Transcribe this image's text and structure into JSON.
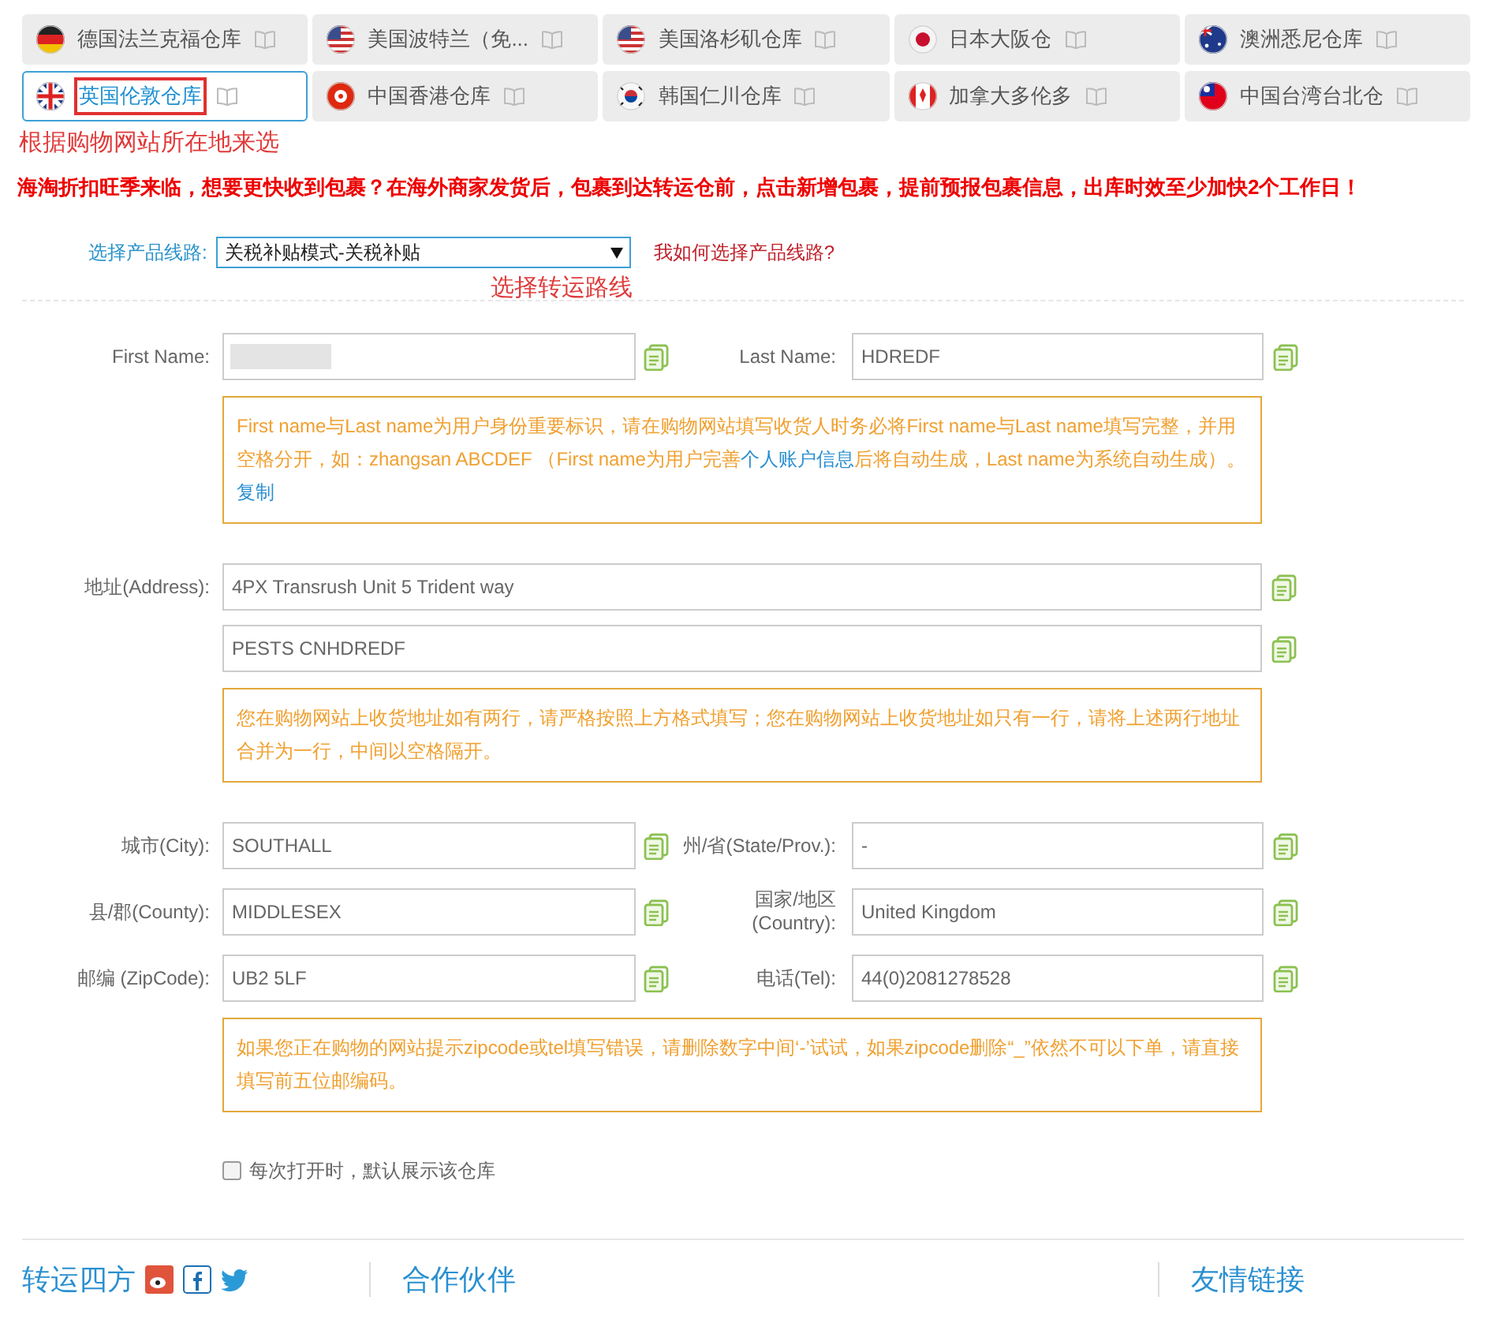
{
  "tabs": [
    {
      "label": "德国法兰克福仓库",
      "kind": "de",
      "selected": false,
      "highlighted": false
    },
    {
      "label": "美国波特兰（免...",
      "kind": "us",
      "selected": false,
      "highlighted": false
    },
    {
      "label": "美国洛杉矶仓库",
      "kind": "us",
      "selected": false,
      "highlighted": false
    },
    {
      "label": "日本大阪仓",
      "kind": "jp",
      "selected": false,
      "highlighted": false
    },
    {
      "label": "澳洲悉尼仓库",
      "kind": "au",
      "selected": false,
      "highlighted": false
    },
    {
      "label": "英国伦敦仓库",
      "kind": "gb",
      "selected": true,
      "highlighted": true
    },
    {
      "label": "中国香港仓库",
      "kind": "hk",
      "selected": false,
      "highlighted": false
    },
    {
      "label": "韩国仁川仓库",
      "kind": "kr",
      "selected": false,
      "highlighted": false
    },
    {
      "label": "加拿大多伦多",
      "kind": "ca",
      "selected": false,
      "highlighted": false
    },
    {
      "label": "中国台湾台北仓",
      "kind": "tw",
      "selected": false,
      "highlighted": false
    }
  ],
  "tab_annotation": "根据购物网站所在地来选",
  "promo": "海淘折扣旺季来临，想要更快收到包裹？在海外商家发货后，包裹到达转运仓前，点击新增包裹，提前预报包裹信息，出库时效至少加快2个工作日！",
  "route": {
    "label": "选择产品线路:",
    "value": "关税补贴模式-关税补贴",
    "help_link": "我如何选择产品线路?",
    "annotation": "选择转运路线"
  },
  "form": [
    {
      "kind": "pair",
      "fields": [
        {
          "label": "First Name:",
          "redacted": true
        },
        {
          "label": "Last Name:",
          "value": "HDREDF"
        }
      ]
    },
    {
      "kind": "note",
      "segments": [
        {
          "kind": "text",
          "text": "First name与Last name为用户身份重要标识，请在购物网站填写收货人时务必将First name与Last name填写完整，并用空格分开，如：zhangsan ABCDEF （First name为用户完善"
        },
        {
          "kind": "link",
          "text": "个人账户信息"
        },
        {
          "kind": "text",
          "text": "后将自动生成，Last name为系统自动生成）。 "
        },
        {
          "kind": "link",
          "text": "复制"
        }
      ]
    },
    {
      "kind": "full",
      "label": "地址(Address):",
      "value": "4PX Transrush Unit 5 Trident way"
    },
    {
      "kind": "full",
      "value": "PESTS CNHDREDF"
    },
    {
      "kind": "note",
      "segments": [
        {
          "kind": "text",
          "text": "您在购物网站上收货地址如有两行，请严格按照上方格式填写；您在购物网站上收货地址如只有一行，请将上述两行地址合并为一行，中间以空格隔开。"
        }
      ]
    },
    {
      "kind": "pair",
      "fields": [
        {
          "label": "城市(City):",
          "value": "SOUTHALL"
        },
        {
          "label": "州/省(State/Prov.):",
          "value": "-"
        }
      ]
    },
    {
      "kind": "pair",
      "fields": [
        {
          "label": "县/郡(County):",
          "value": "MIDDLESEX"
        },
        {
          "label": "国家/地区 (Country):",
          "value": "United Kingdom"
        }
      ]
    },
    {
      "kind": "pair",
      "fields": [
        {
          "label": "邮编 (ZipCode):",
          "value": "UB2 5LF"
        },
        {
          "label": "电话(Tel):",
          "value": "44(0)2081278528"
        }
      ]
    },
    {
      "kind": "note",
      "segments": [
        {
          "kind": "text",
          "text": "如果您正在购物的网站提示zipcode或tel填写错误，请删除数字中间‘-’试试，如果zipcode删除“_”依然不可以下单，请直接填写前五位邮编码。"
        }
      ]
    }
  ],
  "default_checkbox": {
    "label": "每次打开时，默认展示该仓库",
    "checked": false
  },
  "footer": [
    "转运四方",
    "合作伙伴",
    "友情链接"
  ]
}
